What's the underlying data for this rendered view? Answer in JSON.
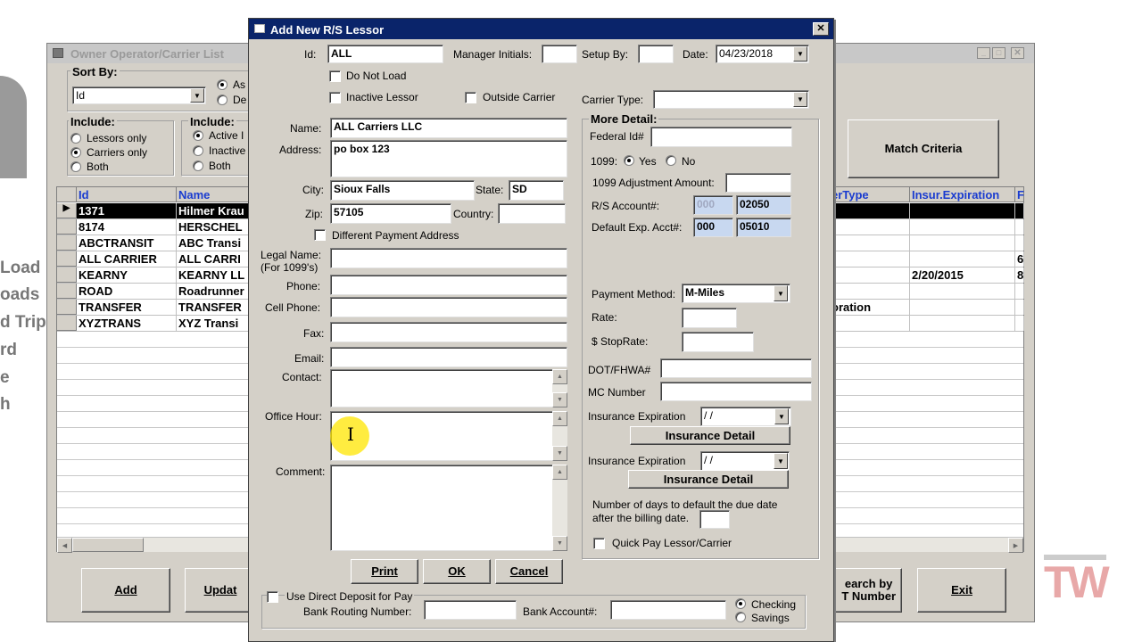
{
  "back_window": {
    "title": "Owner Operator/Carrier List",
    "sort_by_label": "Sort By:",
    "sort_value": "Id",
    "sort_dir": [
      "As",
      "De"
    ],
    "include1_label": "Include:",
    "include1": [
      "Lessors only",
      "Carriers only",
      "Both"
    ],
    "include2_label": "Include:",
    "include2": [
      "Active I",
      "Inactive",
      "Both"
    ],
    "grid_headers": [
      "Id",
      "Name",
      "erType",
      "Insur.Expiration",
      "F"
    ],
    "rows": [
      {
        "id": "1371",
        "name": "Hilmer Krau",
        "type": "",
        "exp": "",
        "f": ""
      },
      {
        "id": "8174",
        "name": "HERSCHEL",
        "type": "",
        "exp": "",
        "f": ""
      },
      {
        "id": "ABCTRANSIT",
        "name": "ABC Transi",
        "type": "",
        "exp": "",
        "f": ""
      },
      {
        "id": "ALL CARRIER",
        "name": "ALL CARRI",
        "type": "",
        "exp": "",
        "f": "6"
      },
      {
        "id": "KEARNY",
        "name": "KEARNY LL",
        "type": "",
        "exp": "2/20/2015",
        "f": "8"
      },
      {
        "id": "ROAD",
        "name": "Roadrunner",
        "type": "",
        "exp": "",
        "f": ""
      },
      {
        "id": "TRANSFER",
        "name": "TRANSFER",
        "type": "oration",
        "exp": "",
        "f": ""
      },
      {
        "id": "XYZTRANS",
        "name": "XYZ Transi",
        "type": "",
        "exp": "",
        "f": ""
      }
    ],
    "match_criteria": "Match Criteria",
    "add": "Add",
    "update": "Updat",
    "search_by": "earch by\nT Number",
    "exit": "Exit"
  },
  "left_bg_text": [
    "Load",
    "oads",
    "d Trip",
    "rd",
    "e",
    "h"
  ],
  "watermark": "TW",
  "dialog": {
    "title": "Add New R/S Lessor",
    "id_label": "Id:",
    "id_value": "ALL",
    "manager_initials_label": "Manager Initials:",
    "manager_initials_value": "",
    "setup_by_label": "Setup By:",
    "setup_by_value": "",
    "date_label": "Date:",
    "date_value": "04/23/2018",
    "do_not_load": "Do Not Load",
    "inactive_lessor": "Inactive Lessor",
    "outside_carrier": "Outside Carrier",
    "carrier_type_label": "Carrier Type:",
    "carrier_type_value": "",
    "name_label": "Name:",
    "name_value": "ALL Carriers LLC",
    "address_label": "Address:",
    "address_value": "po box 123",
    "city_label": "City:",
    "city_value": "Sioux Falls",
    "state_label": "State:",
    "state_value": "SD",
    "zip_label": "Zip:",
    "zip_value": "57105",
    "country_label": "Country:",
    "country_value": "",
    "diff_payment": "Different Payment Address",
    "legal_name_label": "Legal Name:",
    "legal_name_sub": "(For 1099's)",
    "phone_label": "Phone:",
    "cell_label": "Cell Phone:",
    "fax_label": "Fax:",
    "email_label": "Email:",
    "contact_label": "Contact:",
    "office_label": "Office Hour:",
    "comment_label": "Comment:",
    "more_detail": "More Detail:",
    "federal_id_label": "Federal Id#",
    "t1099_label": "1099:",
    "yes": "Yes",
    "no": "No",
    "adj_label": "1099 Adjustment Amount:",
    "rs_account_label": "R/S Account#:",
    "rs_account_a": "000",
    "rs_account_b": "02050",
    "default_exp_label": "Default Exp. Acct#:",
    "default_exp_a": "000",
    "default_exp_b": "05010",
    "payment_method_label": "Payment Method:",
    "payment_method_value": "M-Miles",
    "rate_label": "Rate:",
    "stoprate_label": "$ StopRate:",
    "dot_label": "DOT/FHWA#",
    "mc_label": "MC Number",
    "ins_exp_label": "Insurance Expiration",
    "ins_exp_value": " / /",
    "ins_detail": "Insurance Detail",
    "days_text_1": "Number of days to default the due date",
    "days_text_2": "after the billing date.",
    "quick_pay": "Quick Pay Lessor/Carrier",
    "print": "Print",
    "ok": "OK",
    "cancel": "Cancel",
    "direct_deposit": "Use Direct Deposit for Pay",
    "bank_routing_label": "Bank Routing Number:",
    "bank_account_label": "Bank Account#:",
    "checking": "Checking",
    "savings": "Savings"
  }
}
